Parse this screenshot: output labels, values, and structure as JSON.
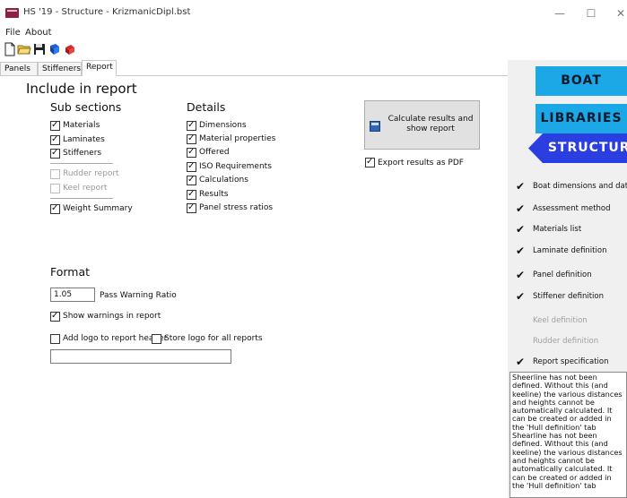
{
  "window": {
    "title": "HS '19 - Structure - KrizmanicDipl.bst",
    "minimize_glyph": "—",
    "maximize_glyph": "☐",
    "close_glyph": "✕"
  },
  "menu": [
    "File",
    "About"
  ],
  "toolbar": {
    "icons": [
      "new-document-icon",
      "open-folder-icon",
      "save-icon",
      "blue-book-icon",
      "red-book-icon"
    ]
  },
  "tabs": [
    {
      "label": "Panels",
      "active": false
    },
    {
      "label": "Stiffeners",
      "active": false
    },
    {
      "label": "Report",
      "active": true
    }
  ],
  "report": {
    "heading": "Include in report",
    "sub_sections": {
      "heading": "Sub sections",
      "items": [
        {
          "label": "Materials",
          "checked": true,
          "enabled": true
        },
        {
          "label": "Laminates",
          "checked": true,
          "enabled": true
        },
        {
          "label": "Stiffeners",
          "checked": true,
          "enabled": true
        },
        {
          "label": "Rudder report",
          "checked": false,
          "enabled": false
        },
        {
          "label": "Keel report",
          "checked": false,
          "enabled": false
        },
        {
          "label": "Weight Summary",
          "checked": true,
          "enabled": true
        }
      ]
    },
    "details": {
      "heading": "Details",
      "items": [
        {
          "label": "Dimensions",
          "checked": true
        },
        {
          "label": "Material properties",
          "checked": true
        },
        {
          "label": "Offered",
          "checked": true
        },
        {
          "label": "ISO Requirements",
          "checked": true
        },
        {
          "label": "Calculations",
          "checked": true
        },
        {
          "label": "Results",
          "checked": true
        },
        {
          "label": "Panel stress ratios",
          "checked": true
        }
      ]
    },
    "calculate_button": "Calculate results and show report",
    "export_pdf": {
      "label": "Export results as PDF",
      "checked": true
    },
    "format": {
      "heading": "Format",
      "pass_warning_value": "1.05",
      "pass_warning_label": "Pass Warning Ratio",
      "show_warnings": {
        "label": "Show warnings in report",
        "checked": true
      },
      "add_logo": {
        "label": "Add logo to report header",
        "checked": false
      },
      "store_logo": {
        "label": "Store logo for all reports",
        "checked": false
      },
      "logo_path": ""
    }
  },
  "sidepanel": {
    "nav": [
      "BOAT",
      "LIBRARIES",
      "STRUCTURE"
    ],
    "steps": [
      {
        "label": "Boat dimensions and data",
        "done": true
      },
      {
        "label": "Assessment method",
        "done": true
      },
      {
        "label": "Materials list",
        "done": true
      },
      {
        "label": "Laminate definition",
        "done": true
      },
      {
        "label": "Panel definition",
        "done": true
      },
      {
        "label": "Stiffener definition",
        "done": true
      },
      {
        "label": "Keel definition",
        "done": false
      },
      {
        "label": "Rudder definition",
        "done": false
      },
      {
        "label": "Report specification",
        "done": true
      }
    ],
    "message": "Sheerline has not been defined. Without this (and keeline) the various distances and heights cannot be automatically calculated. It can be created or added in the 'Hull definition' tab Shearline has not been defined. Without this (and keeline) the various distances and heights cannot be automatically calculated. It can be created or added in the 'Hull definition' tab"
  },
  "colors": {
    "nav_blue": "#1ca7e6",
    "nav_active": "#2b3fe0",
    "panel_bg": "#f0f0f0",
    "button_bg": "#e1e1e1"
  }
}
